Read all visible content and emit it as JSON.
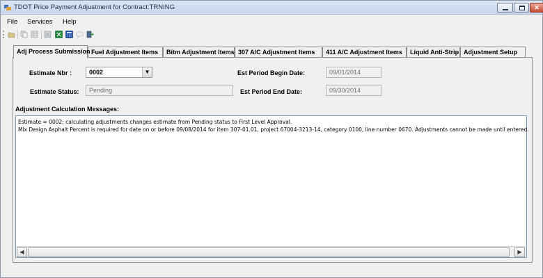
{
  "window": {
    "title": "TDOT Price Payment Adjustment for Contract:TRNING"
  },
  "menu": [
    "File",
    "Services",
    "Help"
  ],
  "toolbar": {
    "icons": [
      "open-icon",
      "copy-icon",
      "grid-icon",
      "calculator-grey-icon",
      "excel-icon",
      "excel-alt-icon",
      "calculator-icon",
      "comment-icon",
      "exit-icon"
    ]
  },
  "tabs": [
    "Adj Process Submission",
    "Fuel Adjustment Items",
    "Bitm Adjustment Items",
    "307 A/C Adjustment Items",
    "411 A/C Adjustment Items",
    "Liquid Anti-Strip",
    "Adjustment Setup"
  ],
  "form": {
    "estimate_nbr_label": "Estimate Nbr :",
    "estimate_nbr_value": "0002",
    "estimate_status_label": "Estimate Status:",
    "estimate_status_value": "Pending",
    "begin_date_label": "Est Period Begin Date:",
    "begin_date_value": "09/01/2014",
    "end_date_label": "Est Period End Date:",
    "end_date_value": "09/30/2014"
  },
  "messages": {
    "heading": "Adjustment Calculation Messages:",
    "lines": [
      "Estimate = 0002; calculating adjustments changes estimate from Pending status to First Level Approval.",
      "Mix Design Asphalt Percent is required for date on or before 09/08/2014 for item 307-01.01, project 67004-3213-14, category 0100, line number 0670.  Adjustments cannot be made until entered."
    ]
  },
  "colors": {
    "title_bar": "#c6d6ec",
    "close_button": "#c74a32",
    "excel_green": "#1e8c3a",
    "calculator_blue": "#1f4fa8"
  }
}
